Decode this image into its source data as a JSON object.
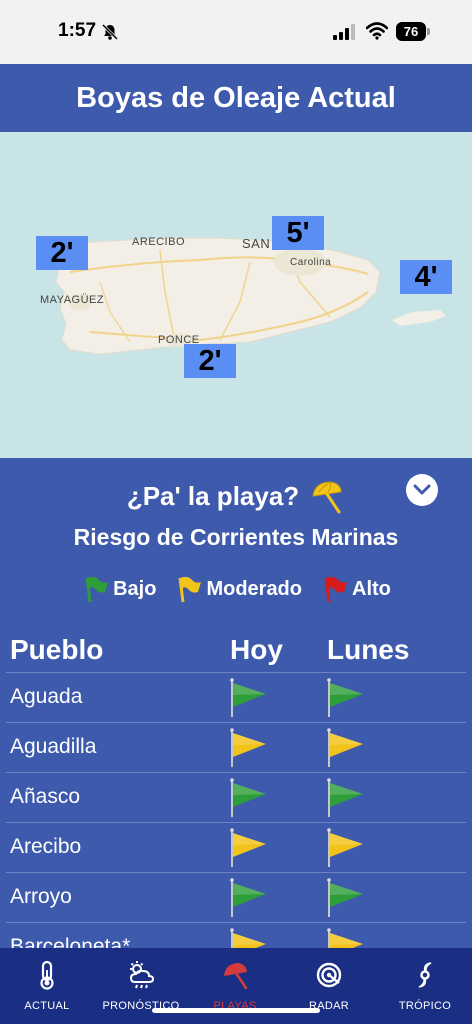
{
  "status": {
    "time": "1:57",
    "battery": "76"
  },
  "header": {
    "title": "Boyas de Oleaje Actual"
  },
  "map": {
    "cities": [
      "ARECIBO",
      "SAN",
      "Carolina",
      "MAYAGÜEZ",
      "PONCE"
    ],
    "buoys": [
      "2'",
      "5'",
      "4'",
      "2'"
    ]
  },
  "panel": {
    "title": "¿Pa' la playa?",
    "subtitle": "Riesgo de Corrientes Marinas",
    "legend": [
      {
        "label": "Bajo",
        "color": "#2e9e3a"
      },
      {
        "label": "Moderado",
        "color": "#f2c318"
      },
      {
        "label": "Alto",
        "color": "#d81b1b"
      }
    ],
    "columns": {
      "town": "Pueblo",
      "today": "Hoy",
      "tomorrow": "Lunes"
    },
    "rows": [
      {
        "name": "Aguada",
        "today": "green",
        "tomorrow": "green"
      },
      {
        "name": "Aguadilla",
        "today": "yellow",
        "tomorrow": "yellow"
      },
      {
        "name": "Añasco",
        "today": "green",
        "tomorrow": "green"
      },
      {
        "name": "Arecibo",
        "today": "yellow",
        "tomorrow": "yellow"
      },
      {
        "name": "Arroyo",
        "today": "green",
        "tomorrow": "green"
      },
      {
        "name": "Barceloneta*",
        "today": "yellow",
        "tomorrow": "yellow"
      }
    ]
  },
  "nav": [
    {
      "label": "ACTUAL",
      "icon": "thermometer-icon"
    },
    {
      "label": "PRONÓSTICO",
      "icon": "forecast-icon"
    },
    {
      "label": "PLAYAS",
      "icon": "umbrella-icon",
      "active": true
    },
    {
      "label": "RADAR",
      "icon": "radar-icon"
    },
    {
      "label": "TRÓPICO",
      "icon": "hurricane-icon"
    }
  ],
  "colors": {
    "flag_green": "#2e9e3a",
    "flag_yellow": "#f2c318",
    "flag_red": "#d81b1b",
    "nav_active": "#d43c3c"
  }
}
